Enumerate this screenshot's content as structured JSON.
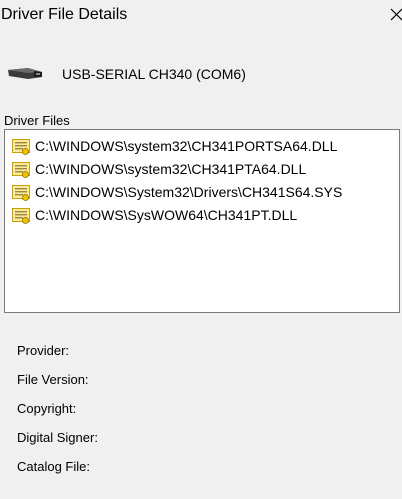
{
  "window": {
    "title": "Driver File Details",
    "close_glyph": "✕"
  },
  "device": {
    "name": "USB-SERIAL CH340 (COM6)",
    "icon": "usb-connector-icon"
  },
  "driver_files": {
    "label": "Driver Files",
    "icon": "driver-file-icon",
    "items": [
      "C:\\WINDOWS\\system32\\CH341PORTSA64.DLL",
      "C:\\WINDOWS\\system32\\CH341PTA64.DLL",
      "C:\\WINDOWS\\System32\\Drivers\\CH341S64.SYS",
      "C:\\WINDOWS\\SysWOW64\\CH341PT.DLL"
    ]
  },
  "details": {
    "provider_label": "Provider:",
    "file_version_label": "File Version:",
    "copyright_label": "Copyright:",
    "digital_signer_label": "Digital Signer:",
    "catalog_file_label": "Catalog File:"
  },
  "colors": {
    "window_bg": "#f0f0f0",
    "list_bg": "#ffffff",
    "list_border": "#7a7a7a",
    "icon_yellow": "#f2c200"
  }
}
